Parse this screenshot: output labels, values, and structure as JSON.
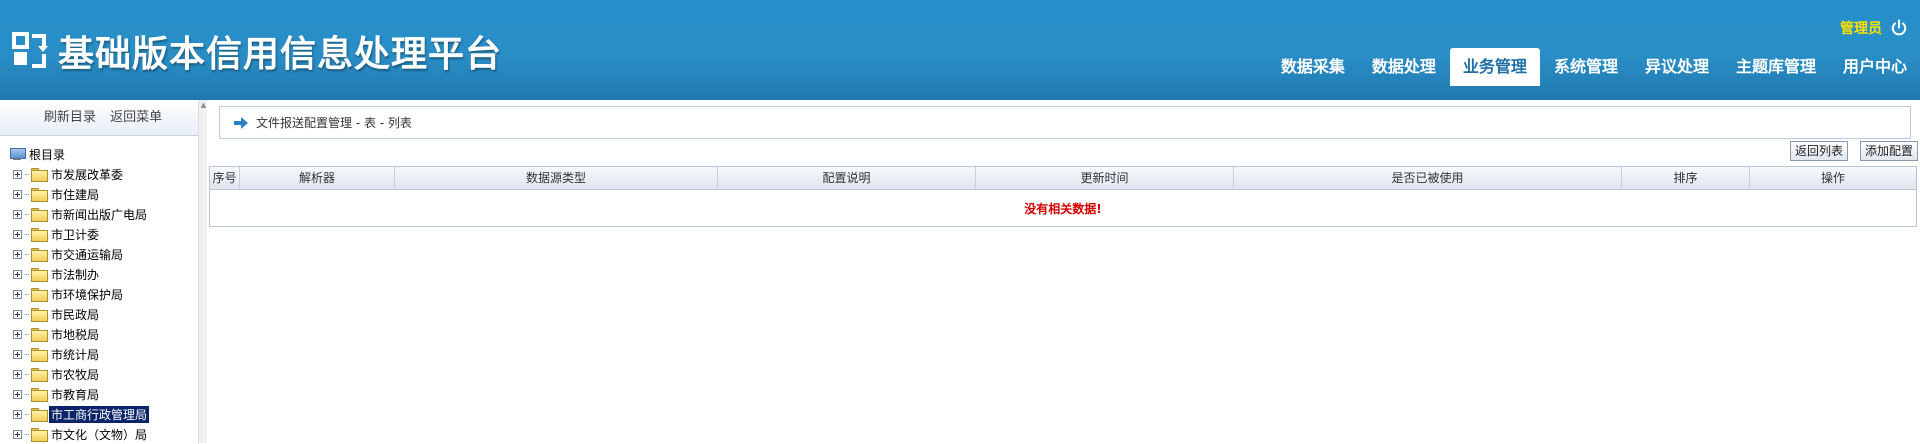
{
  "app": {
    "title": "基础版本信用信息处理平台"
  },
  "user": {
    "name": "管理员",
    "logout_icon": "power-icon"
  },
  "nav": {
    "items": [
      {
        "label": "数据采集"
      },
      {
        "label": "数据处理"
      },
      {
        "label": "业务管理",
        "active": true
      },
      {
        "label": "系统管理"
      },
      {
        "label": "异议处理"
      },
      {
        "label": "主题库管理"
      },
      {
        "label": "用户中心"
      }
    ]
  },
  "sidebar": {
    "refresh_label": "刷新目录",
    "back_label": "返回菜单",
    "root_label": "根目录",
    "items": [
      {
        "label": "市发展改革委"
      },
      {
        "label": "市住建局"
      },
      {
        "label": "市新闻出版广电局"
      },
      {
        "label": "市卫计委"
      },
      {
        "label": "市交通运输局"
      },
      {
        "label": "市法制办"
      },
      {
        "label": "市环境保护局"
      },
      {
        "label": "市民政局"
      },
      {
        "label": "市地税局"
      },
      {
        "label": "市统计局"
      },
      {
        "label": "市农牧局"
      },
      {
        "label": "市教育局"
      },
      {
        "label": "市工商行政管理局",
        "selected": true
      },
      {
        "label": "市文化（文物）局"
      }
    ]
  },
  "main": {
    "breadcrumb": "文件报送配置管理 - 表 - 列表",
    "buttons": {
      "back_list": "返回列表",
      "add_config": "添加配置"
    },
    "table": {
      "columns": [
        "序号",
        "解析器",
        "数据源类型",
        "配置说明",
        "更新时间",
        "是否已被使用",
        "排序",
        "操作"
      ],
      "empty_text": "没有相关数据!"
    }
  },
  "colors": {
    "header_bg": "#2590cd",
    "user_name": "#ffe000",
    "nav_active_bg": "#ffffff",
    "nav_active_text": "#1f6fa6",
    "tree_selected_bg": "#0a246a",
    "empty_text": "#d20000"
  }
}
